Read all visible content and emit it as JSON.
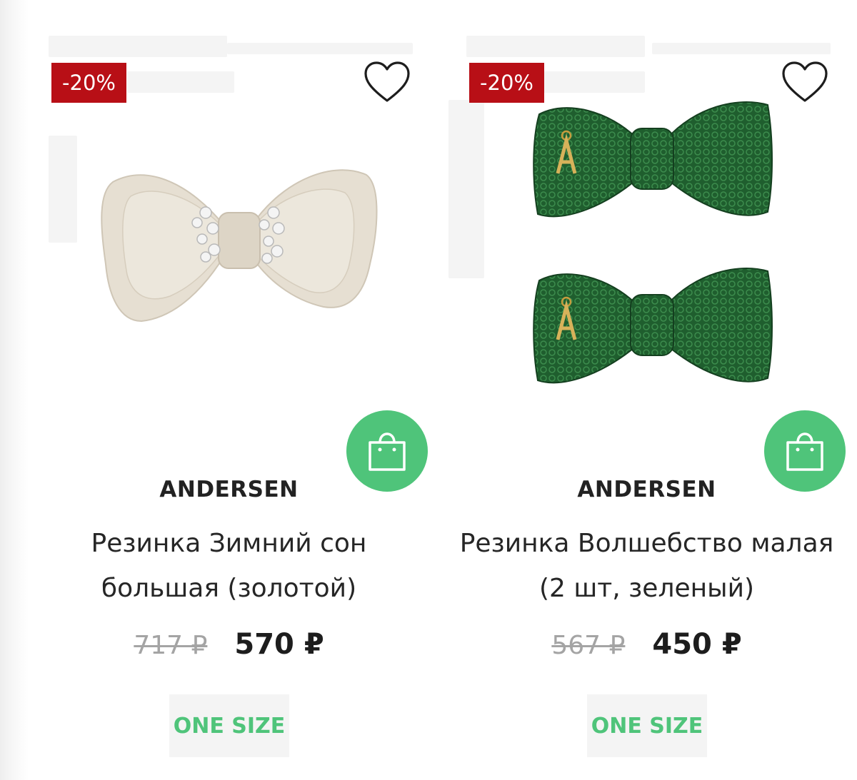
{
  "products": [
    {
      "discount": "-20%",
      "brand": "ANDERSEN",
      "name_line1": "Резинка Зимний сон",
      "name_line2": "большая (золотой)",
      "old_price": "717 ₽",
      "new_price": "570 ₽",
      "size": "ONE SIZE",
      "icons": {
        "favorite": "heart-icon",
        "cart": "shopping-bag-icon"
      }
    },
    {
      "discount": "-20%",
      "brand": "ANDERSEN",
      "name_line1": "Резинка Волшебство малая",
      "name_line2": "(2 шт, зеленый)",
      "old_price": "567 ₽",
      "new_price": "450 ₽",
      "size": "ONE SIZE",
      "icons": {
        "favorite": "heart-icon",
        "cart": "shopping-bag-icon"
      }
    }
  ],
  "colors": {
    "discount_badge": "#b80f16",
    "cart_button": "#4fc47a",
    "size_text": "#4fc47a",
    "old_price": "#a4a4a4"
  }
}
